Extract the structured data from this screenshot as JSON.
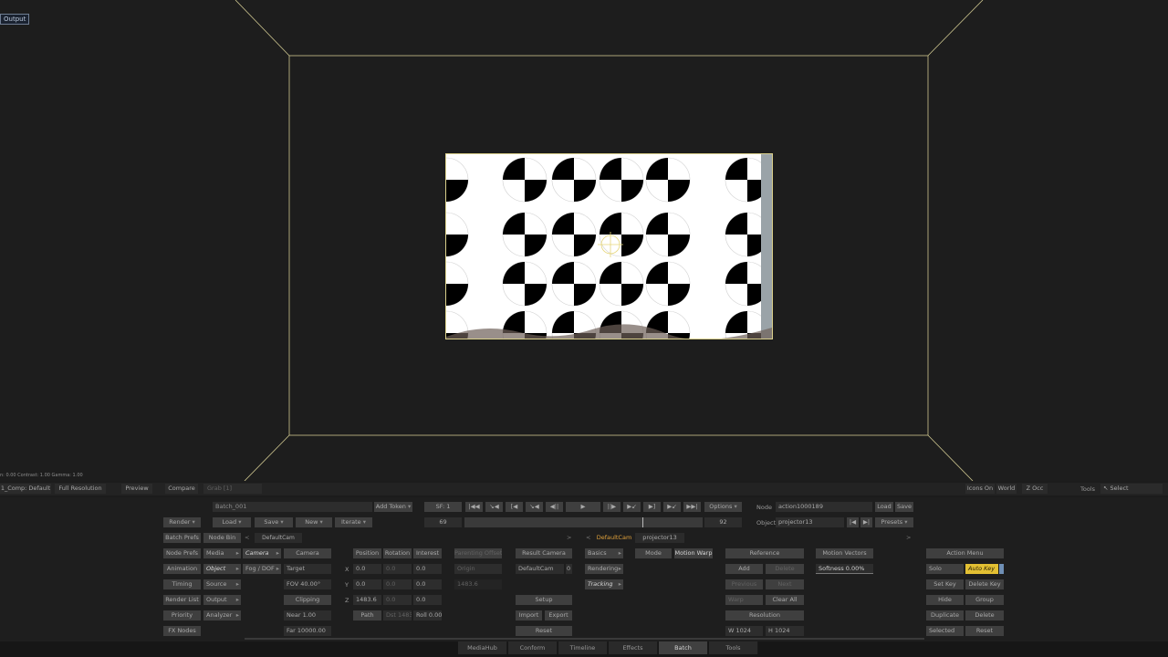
{
  "viewport": {
    "output_label": "Output",
    "stats": "n: 0.00   Contrast: 1.00   Gamma: 1.00"
  },
  "viewer_bar": {
    "comp": "1_Comp: Default",
    "resolution": "Full Resolution",
    "preview": "Preview",
    "compare": "Compare",
    "grab": "Grab [1]",
    "icons_on": "Icons On",
    "world": "World",
    "z_occ": "Z Occ",
    "tools": "Tools",
    "select": "Select"
  },
  "batch": {
    "name": "Batch_001",
    "add_token": "Add Token",
    "render": "Render",
    "load": "Load",
    "save": "Save",
    "new": "New",
    "iterate": "Iterate",
    "batch_prefs": "Batch Prefs",
    "node_bin": "Node Bin",
    "node_prefs": "Node Prefs",
    "animation": "Animation",
    "timing": "Timing",
    "render_list": "Render List",
    "priority": "Priority",
    "fx_nodes": "FX Nodes",
    "default_cam": "DefaultCam"
  },
  "transport": {
    "sf": "SF: 1",
    "frame": "69",
    "end_frame": "92",
    "options": "Options"
  },
  "node_panel": {
    "node_label": "Node",
    "node_value": "action1000189",
    "load": "Load",
    "save": "Save",
    "object_label": "Object",
    "object_value": "projector13",
    "presets": "Presets"
  },
  "object_menu": {
    "media": "Media",
    "camera": "Camera",
    "object": "Object",
    "fog_dof": "Fog / DOF",
    "source": "Source",
    "output": "Output",
    "analyzer": "Analyzer"
  },
  "camera": {
    "camera_btn": "Camera",
    "target": "Target",
    "fov": "FOV 40.00°",
    "clipping": "Clipping",
    "near": "Near 1.00",
    "far": "Far 10000.00"
  },
  "transform": {
    "position": "Position",
    "rotation": "Rotation",
    "interest": "Interest",
    "x": "X",
    "y": "Y",
    "z": "Z",
    "px": "0.0",
    "rx": "0.0",
    "ix": "0.0",
    "py": "0.0",
    "ry": "0.0",
    "iy": "0.0",
    "pz": "1483.6",
    "rz": "0.0",
    "iz": "0.0",
    "path": "Path",
    "dist": "Dst 1483",
    "roll": "Roll 0.00",
    "parenting_offset": "Parenting Offset",
    "origin": "Origin",
    "origin_value": "1483.6"
  },
  "result_camera": {
    "label": "Result Camera",
    "value": "DefaultCam",
    "index": "0",
    "setup": "Setup",
    "import": "Import",
    "export": "Export",
    "reset": "Reset"
  },
  "cam_tabs": {
    "default_cam": "DefaultCam",
    "projector": "projector13"
  },
  "basics": {
    "basics": "Basics",
    "rendering": "Rendering",
    "tracking": "Tracking",
    "mode": "Mode",
    "motion_warp": "Motion Warp"
  },
  "reference": {
    "reference": "Reference",
    "add": "Add",
    "delete": "Delete",
    "previous": "Previous",
    "next": "Next",
    "warp": "Warp",
    "clear_all": "Clear All",
    "resolution": "Resolution",
    "w": "W 1024",
    "h": "H 1024"
  },
  "motion": {
    "vectors": "Motion Vectors",
    "softness": "Softness 0.00%"
  },
  "action_menu": {
    "title": "Action Menu",
    "solo": "Solo",
    "auto_key": "Auto Key",
    "set_key": "Set Key",
    "delete_key": "Delete Key",
    "hide": "Hide",
    "group": "Group",
    "duplicate": "Duplicate",
    "delete": "Delete",
    "selected": "Selected",
    "reset": "Reset"
  },
  "tabs": [
    "MediaHub",
    "Conform",
    "Timeline",
    "Effects",
    "Batch",
    "Tools"
  ],
  "active_tab": "Batch",
  "colors": {
    "frame_line": "#d9cf8a",
    "auto_key": "#e3c033",
    "accent_orange": "#e1a23b"
  }
}
